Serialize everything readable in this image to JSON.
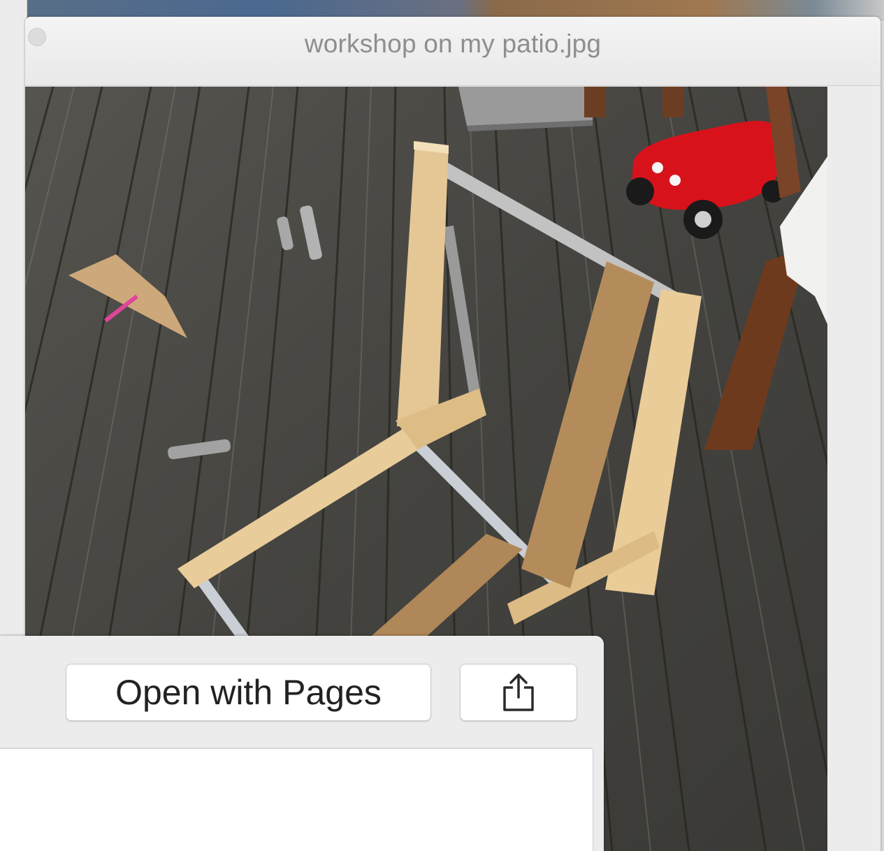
{
  "window": {
    "title": "workshop on my patio.jpg"
  },
  "photo": {
    "subject": "image"
  },
  "actions": {
    "open_with_label": "Open with Pages",
    "share_icon": "share-icon"
  },
  "colors": {
    "window_bg": "#ececec",
    "title_text": "#8e8e8e",
    "button_bg": "#ffffff",
    "deck": "#3f3f3d"
  }
}
